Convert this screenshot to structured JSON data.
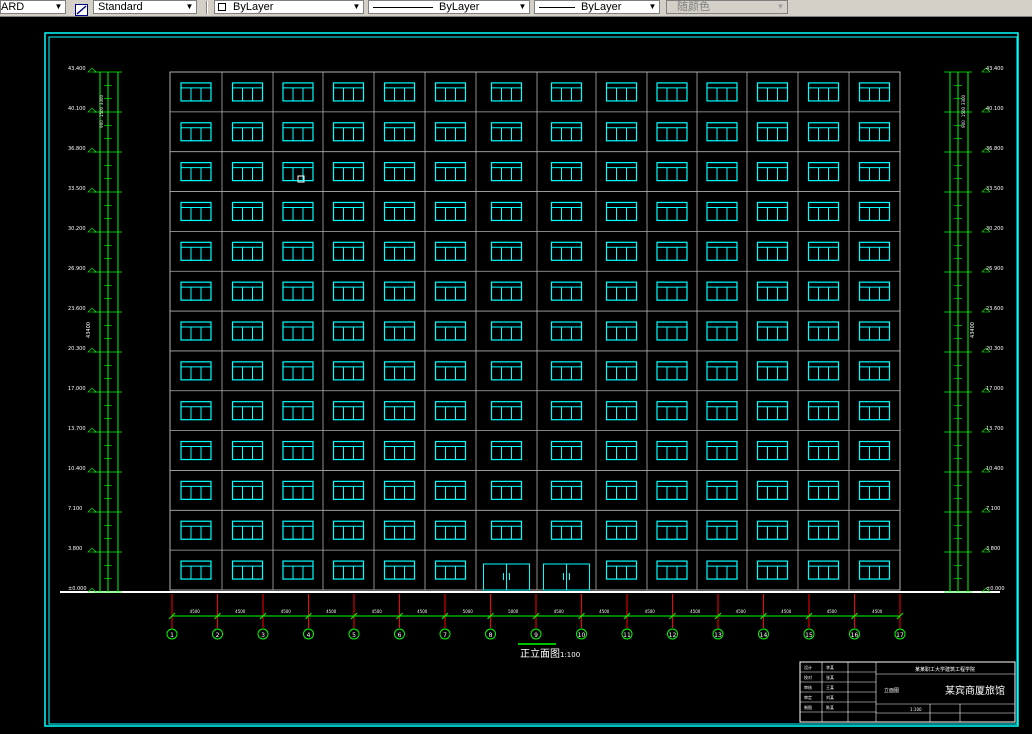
{
  "toolbar": {
    "textstyle_value": "ARD",
    "dimstyle_value": "Standard",
    "layer_value": "ByLayer",
    "linetype_value": "ByLayer",
    "lineweight_value": "ByLayer",
    "color_value": "随颜色"
  },
  "drawing": {
    "title": "正立面图",
    "scale": "1:100",
    "axis_labels": [
      "1",
      "2",
      "3",
      "4",
      "5",
      "6",
      "7",
      "8",
      "9",
      "10",
      "11",
      "12",
      "13",
      "14",
      "15",
      "16",
      "17"
    ],
    "spans": [
      "4500",
      "4500",
      "4500",
      "4500",
      "4500",
      "4500",
      "5000",
      "5000",
      "4500",
      "4500",
      "4500",
      "4500",
      "4500",
      "4500",
      "4500",
      "4500"
    ],
    "floor_count": 13,
    "bay_count": 14,
    "left_elevations": [
      "43.400",
      "40.100",
      "36.800",
      "33.500",
      "30.200",
      "26.900",
      "23.600",
      "20.300",
      "17.000",
      "13.700",
      "10.400",
      "7.100",
      "3.800",
      "±0.000"
    ],
    "right_elevations": [
      "43.400",
      "40.100",
      "36.800",
      "33.500",
      "30.200",
      "26.900",
      "23.600",
      "20.300",
      "17.000",
      "13.700",
      "10.400",
      "7.100",
      "3.800",
      "±0.000"
    ],
    "overall_height": "43400",
    "dim_side_labels": [
      "3300",
      "1500",
      "900"
    ],
    "title_block": {
      "school": "某某职工大学建筑工程学院",
      "project": "某宾商厦旅馆",
      "drawing_kind": "立面图",
      "scale_label": "1:100",
      "row_labels": [
        "设计",
        "校对",
        "审核",
        "审定",
        "制图"
      ],
      "row_names": [
        "李某",
        "张某",
        "王某",
        "刘某",
        "陈某"
      ]
    }
  },
  "colors": {
    "frame": "#00ffff",
    "window": "#00ffff",
    "dim": "#00ff00",
    "text": "#ffffff",
    "axis_tick": "#ff0000",
    "ground": "#ffffff",
    "facade": "#b0b0b0"
  }
}
